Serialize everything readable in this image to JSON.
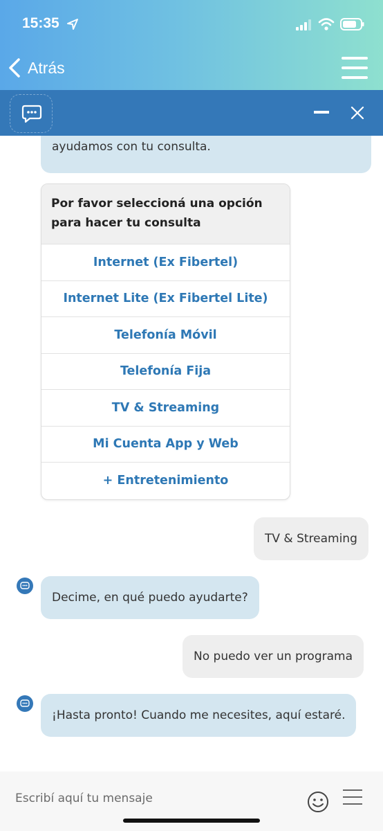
{
  "status_bar": {
    "time": "15:35"
  },
  "nav": {
    "back_label": "Atrás"
  },
  "messages": {
    "partial_bot_text": "ayudamos con tu consulta.",
    "options_card": {
      "title": "Por favor seleccioná una opción para hacer tu consulta",
      "options": [
        "Internet (Ex Fibertel)",
        "Internet Lite (Ex Fibertel Lite)",
        "Telefonía Móvil",
        "Telefonía Fija",
        "TV & Streaming",
        "Mi Cuenta App y Web",
        "+ Entretenimiento"
      ]
    },
    "user_1": "TV & Streaming",
    "bot_1": "Decime, en qué puedo ayudarte?",
    "user_2": "No puedo ver un programa",
    "bot_2": "¡Hasta pronto! Cuando me necesites, aquí estaré."
  },
  "input": {
    "placeholder": "Escribí aquí tu mensaje"
  },
  "colors": {
    "chat_header": "#3478b8",
    "bot_bubble": "#d4e6f0",
    "user_bubble": "#eeeeee",
    "option_text": "#2e78b5"
  }
}
